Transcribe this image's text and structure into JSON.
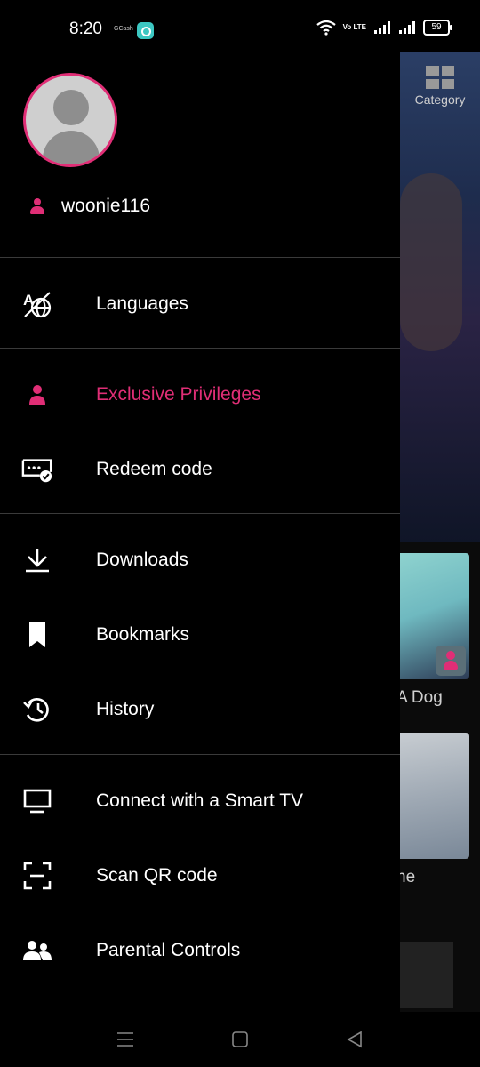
{
  "status_bar": {
    "time": "8:20",
    "gcash_label": "GCash",
    "network_label": "Vo LTE",
    "battery": "59"
  },
  "background": {
    "category_label": "Category",
    "items": [
      {
        "title": "A Dog"
      },
      {
        "title": "ne"
      }
    ]
  },
  "drawer": {
    "username": "woonie116",
    "menu": {
      "languages": "Languages",
      "exclusive_privileges": "Exclusive Privileges",
      "redeem_code": "Redeem code",
      "downloads": "Downloads",
      "bookmarks": "Bookmarks",
      "history": "History",
      "smart_tv": "Connect with a Smart TV",
      "scan_qr": "Scan QR code",
      "parental_controls": "Parental Controls"
    }
  },
  "colors": {
    "accent": "#e02e76",
    "background": "#000000",
    "divider": "#3a3a3a"
  },
  "icons": [
    "languages-icon",
    "user-icon",
    "redeem-icon",
    "download-icon",
    "bookmark-icon",
    "history-icon",
    "tv-icon",
    "scan-icon",
    "parental-icon"
  ]
}
